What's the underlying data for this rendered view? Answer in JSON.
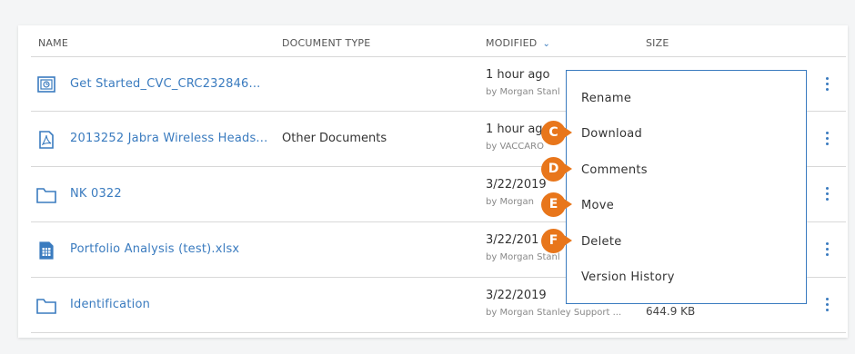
{
  "table": {
    "headers": {
      "name": "NAME",
      "doc_type": "DOCUMENT TYPE",
      "modified": "MODIFIED",
      "size": "SIZE"
    },
    "rows": [
      {
        "name": "Get Started_CVC_CRC232846...",
        "doc_type": "",
        "modified": "1 hour ago",
        "by": "by Morgan Stanl",
        "size": "",
        "icon": "presentation-icon"
      },
      {
        "name": "2013252 Jabra Wireless Heads...",
        "doc_type": "Other Documents",
        "modified": "1 hour ag",
        "by": "by VACCARO",
        "size": "",
        "icon": "pdf-icon"
      },
      {
        "name": "NK 0322",
        "doc_type": "",
        "modified": "3/22/2019",
        "by": "by Morgan",
        "size": "",
        "icon": "folder-icon"
      },
      {
        "name": "Portfolio Analysis (test).xlsx",
        "doc_type": "",
        "modified": "3/22/201",
        "by": "by Morgan Stanl",
        "size": "",
        "icon": "spreadsheet-icon"
      },
      {
        "name": "Identification",
        "doc_type": "",
        "modified": "3/22/2019",
        "by": "by Morgan Stanley Support ...",
        "size": "644.9 KB",
        "icon": "folder-icon"
      }
    ]
  },
  "context_menu": {
    "items": [
      "Rename",
      "Download",
      "Comments",
      "Move",
      "Delete",
      "Version History"
    ]
  },
  "callouts": [
    "C",
    "D",
    "E",
    "F"
  ],
  "colors": {
    "link": "#3a7bbf",
    "callout": "#e8761b"
  }
}
